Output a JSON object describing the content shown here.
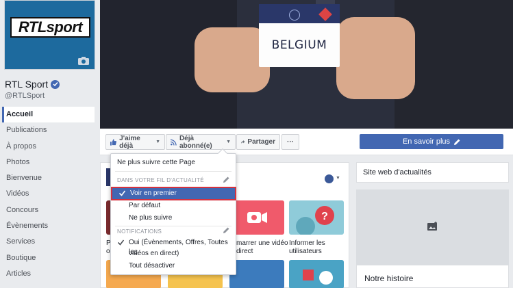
{
  "page": {
    "logo_text": "RTLsport",
    "name": "RTL Sport",
    "handle": "@RTLSport"
  },
  "sidebar": {
    "items": [
      {
        "label": "Accueil"
      },
      {
        "label": "Publications"
      },
      {
        "label": "À propos"
      },
      {
        "label": "Photos"
      },
      {
        "label": "Bienvenue"
      },
      {
        "label": "Vidéos"
      },
      {
        "label": "Concours"
      },
      {
        "label": "Évènements"
      },
      {
        "label": "Services"
      },
      {
        "label": "Boutique"
      },
      {
        "label": "Articles"
      }
    ]
  },
  "cover": {
    "card_text": "BELGIUM"
  },
  "actions": {
    "like_label": "J'aime déjà",
    "follow_label": "Déjà abonné(e)",
    "share_label": "Partager",
    "more_label": "···",
    "cta_label": "En savoir plus"
  },
  "dropdown": {
    "unfollow": "Ne plus suivre cette Page",
    "section_feed": "DANS VOTRE FIL D'ACTUALITÉ",
    "see_first": "Voir en premier",
    "default": "Par défaut",
    "stop_following": "Ne plus suivre",
    "section_notif": "NOTIFICATIONS",
    "notif_on_line1": "Oui (Évènements, Offres, Toutes les",
    "notif_on_line2": "vidéos en direct)",
    "notif_off": "Tout désactiver"
  },
  "tiles": {
    "t1_label_a": "Pa",
    "t1_label_b": "ou",
    "t2_label_a": "marrer une vidéo",
    "t2_label_b": "direct",
    "t3_label_a": "Informer les",
    "t3_label_b": "utilisateurs"
  },
  "right": {
    "site_title": "Site web d'actualités",
    "story_title": "Notre histoire"
  }
}
